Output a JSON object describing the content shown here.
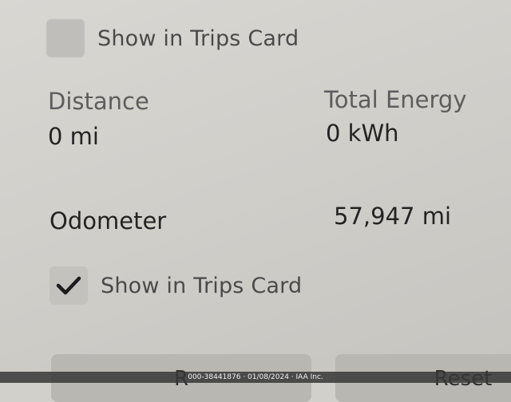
{
  "trip_a": {
    "show_in_trips_card_label": "Show in Trips Card",
    "show_in_trips_card_checked": false
  },
  "trip_b": {
    "distance_label": "Distance",
    "distance_value": "0 mi",
    "total_energy_label": "Total Energy",
    "total_energy_value": "0 kWh"
  },
  "odometer": {
    "label": "Odometer",
    "value": "57,947 mi",
    "show_in_trips_card_label": "Show in Trips Card",
    "show_in_trips_card_checked": true
  },
  "buttons": {
    "left_label": "R",
    "reset_label": "Reset"
  },
  "watermark": "000-38441876 · 01/08/2024 · IAA Inc.",
  "colors": {
    "background": "#d2d0cb",
    "checkbox": "#c4c2bd",
    "text_primary": "#232323",
    "text_secondary": "#5d5d5d"
  },
  "icons": {
    "checkmark": "checkmark-icon"
  }
}
